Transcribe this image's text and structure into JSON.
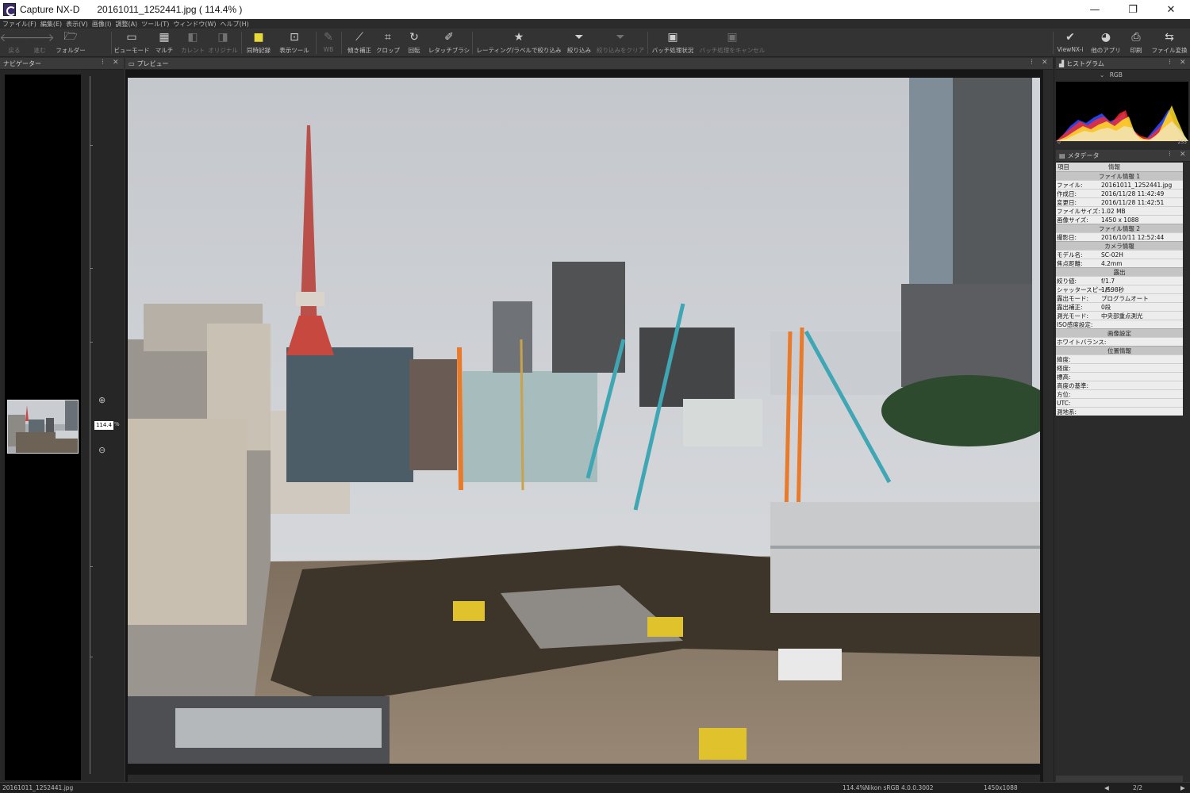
{
  "window": {
    "app_name": "Capture NX-D",
    "file_title": "20161011_1252441.jpg ( 114.4% )",
    "minimize": "—",
    "maximize": "❐",
    "close": "✕"
  },
  "menu": [
    "ファイル(F)",
    "編集(E)",
    "表示(V)",
    "画像(I)",
    "調整(A)",
    "ツール(T)",
    "ウィンドウ(W)",
    "ヘルプ(H)"
  ],
  "toolbar": {
    "back": "戻る",
    "forward": "進む",
    "folder": "フォルダー",
    "view_mode": "ビューモード",
    "multi": "マルチ",
    "current": "カレント",
    "original": "オリジナル",
    "simultaneous": "同時記録",
    "display_tools": "表示ツール",
    "wb": "WB",
    "straighten": "傾き補正",
    "crop": "クロップ",
    "rotate": "回転",
    "retouch": "レタッチブラシ",
    "rating_filter": "レーティング/ラベルで絞り込み",
    "filter": "絞り込み",
    "clear_filter": "絞り込みをクリア",
    "batch_status": "バッチ処理状況",
    "batch_cancel": "バッチ処理をキャンセル",
    "viewnx": "ViewNX-i",
    "other_apps": "他のアプリ",
    "print": "印刷",
    "convert": "ファイル変換"
  },
  "panels": {
    "navigator": "ナビゲーター",
    "preview": "プレビュー",
    "histogram": "ヒストグラム",
    "metadata": "メタデータ"
  },
  "navigator": {
    "zoom_value": "114.4",
    "zoom_unit": "%"
  },
  "histogram": {
    "channel": "RGB",
    "min_label": "0",
    "max_label": "255"
  },
  "metadata": {
    "col_item": "項目",
    "col_info": "情報",
    "sections": [
      {
        "title": "ファイル情報 1",
        "rows": [
          {
            "k": "ファイル:",
            "v": "20161011_1252441.jpg"
          },
          {
            "k": "作成日:",
            "v": "2016/11/28 11:42:49"
          },
          {
            "k": "変更日:",
            "v": "2016/11/28 11:42:51"
          },
          {
            "k": "ファイルサイズ:",
            "v": "1.02 MB"
          },
          {
            "k": "画像サイズ:",
            "v": "1450 x 1088"
          }
        ]
      },
      {
        "title": "ファイル情報 2",
        "rows": [
          {
            "k": "撮影日:",
            "v": "2016/10/11 12:52:44"
          }
        ]
      },
      {
        "title": "カメラ情報",
        "rows": [
          {
            "k": "モデル名:",
            "v": "SC-02H"
          },
          {
            "k": "焦点距離:",
            "v": "4.2mm"
          }
        ]
      },
      {
        "title": "露出",
        "rows": [
          {
            "k": "絞り値:",
            "v": "f/1.7"
          },
          {
            "k": "シャッタースピード:",
            "v": "1/598秒"
          },
          {
            "k": "露出モード:",
            "v": "プログラムオート"
          },
          {
            "k": "露出補正:",
            "v": "0段"
          },
          {
            "k": "測光モード:",
            "v": "中央部重点測光"
          },
          {
            "k": "ISO感度設定:",
            "v": ""
          }
        ]
      },
      {
        "title": "画像設定",
        "rows": [
          {
            "k": "ホワイトバランス:",
            "v": ""
          }
        ]
      },
      {
        "title": "位置情報",
        "rows": [
          {
            "k": "緯度:",
            "v": ""
          },
          {
            "k": "経度:",
            "v": ""
          },
          {
            "k": "標高:",
            "v": ""
          },
          {
            "k": "高度の基準:",
            "v": ""
          },
          {
            "k": "方位:",
            "v": ""
          },
          {
            "k": "UTC:",
            "v": ""
          },
          {
            "k": "測地系:",
            "v": ""
          }
        ]
      }
    ]
  },
  "status": {
    "filename": "20161011_1252441.jpg",
    "zoom": "114.4%",
    "profile": "Nikon sRGB 4.0.0.3002",
    "size": "1450x1088",
    "page": "2/2"
  }
}
